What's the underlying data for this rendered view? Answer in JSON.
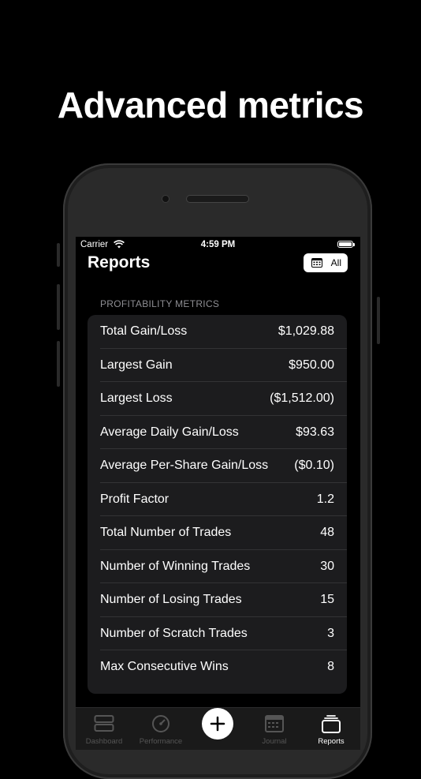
{
  "headline": "Advanced metrics",
  "status_bar": {
    "carrier": "Carrier",
    "time": "4:59 PM"
  },
  "nav": {
    "title": "Reports",
    "filter_label": "All"
  },
  "section": {
    "header": "PROFITABILITY METRICS",
    "rows": [
      {
        "label": "Total Gain/Loss",
        "value": "$1,029.88"
      },
      {
        "label": "Largest Gain",
        "value": "$950.00"
      },
      {
        "label": "Largest Loss",
        "value": "($1,512.00)"
      },
      {
        "label": "Average Daily Gain/Loss",
        "value": "$93.63"
      },
      {
        "label": "Average Per-Share Gain/Loss",
        "value": "($0.10)"
      },
      {
        "label": "Profit Factor",
        "value": "1.2"
      },
      {
        "label": "Total Number of Trades",
        "value": "48"
      },
      {
        "label": "Number of Winning Trades",
        "value": "30"
      },
      {
        "label": "Number of Losing Trades",
        "value": "15"
      },
      {
        "label": "Number of Scratch Trades",
        "value": "3"
      },
      {
        "label": "Max Consecutive Wins",
        "value": "8"
      }
    ]
  },
  "tabbar": {
    "tabs": [
      {
        "label": "Dashboard",
        "icon": "dashboard-icon"
      },
      {
        "label": "Performance",
        "icon": "gauge-icon"
      },
      {
        "label": "",
        "icon": "plus-icon"
      },
      {
        "label": "Journal",
        "icon": "calendar-icon"
      },
      {
        "label": "Reports",
        "icon": "reports-icon",
        "active": true
      }
    ]
  },
  "colors": {
    "background": "#000000",
    "card": "#1c1c1e",
    "secondary_text": "#8e8e93",
    "inactive_tab": "#555555"
  }
}
